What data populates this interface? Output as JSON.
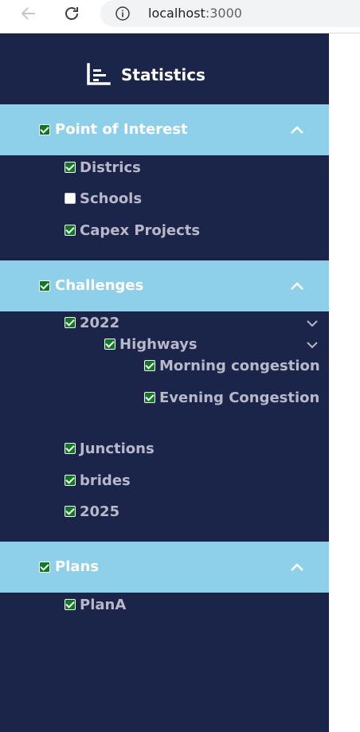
{
  "browser": {
    "url_host": "localhost",
    "url_port": ":3000"
  },
  "sidebar": {
    "title": "Statistics",
    "sections": [
      {
        "label": "Point of Interest",
        "checked": true,
        "expanded": true,
        "items": [
          {
            "label": "Districs",
            "checked": true
          },
          {
            "label": "Schools",
            "checked": false
          },
          {
            "label": "Capex Projects",
            "checked": true
          }
        ]
      },
      {
        "label": "Challenges",
        "checked": true,
        "expanded": true,
        "items": [
          {
            "label": "2022",
            "checked": true,
            "expanded": true
          },
          {
            "label": "Highways",
            "checked": true,
            "expanded": true
          },
          {
            "label": "Morning congestion",
            "checked": true
          },
          {
            "label": "Evening Congestion",
            "checked": true
          },
          {
            "label": "Junctions",
            "checked": true
          },
          {
            "label": "brides",
            "checked": true
          },
          {
            "label": "2025",
            "checked": true
          }
        ]
      },
      {
        "label": "Plans",
        "checked": true,
        "expanded": true,
        "items": [
          {
            "label": "PlanA",
            "checked": true
          }
        ]
      }
    ]
  },
  "colors": {
    "sidebar_bg": "#1b2449",
    "section_band": "#8ecfea",
    "checkbox_checked": "#0d7a1f",
    "item_text": "#b8b8c8"
  }
}
